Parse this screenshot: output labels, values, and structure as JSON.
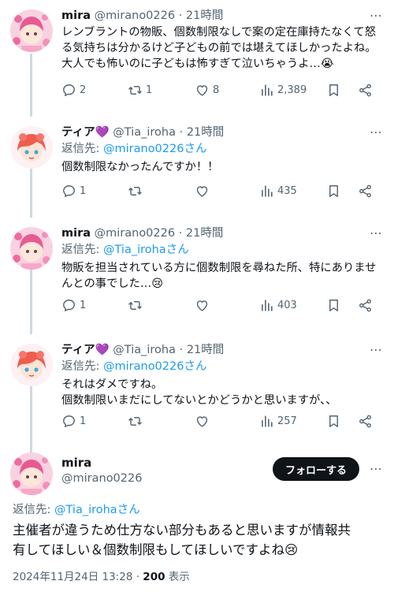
{
  "colors": {
    "accent": "#1d9bf0",
    "muted": "#536471",
    "text": "#0f1419",
    "thread_line": "#cfd9de"
  },
  "tweets": [
    {
      "name": "mira",
      "handle": "@mirano0226",
      "time": "· 21時間",
      "reply_prefix": "",
      "reply_to": "",
      "text_lines": [
        "レンブラントの物販、個数制限なしで案の定在庫持たなくて怒",
        "る気持ちは分かるけど子どもの前では堪えてほしかったよね。",
        "大人でも怖いのに子どもは怖すぎて泣いちゃうよ…😭"
      ],
      "replies": "2",
      "retweets": "1",
      "likes": "8",
      "views": "2,389",
      "avatar": "mira-avatar"
    },
    {
      "name": "ティア💜",
      "handle": "@Tia_iroha",
      "time": "· 21時間",
      "reply_prefix": "返信先: ",
      "reply_to": "@mirano0226さん",
      "text_lines": [
        "個数制限なかったんですか！！"
      ],
      "replies": "1",
      "retweets": "",
      "likes": "",
      "views": "435",
      "avatar": "tia-avatar"
    },
    {
      "name": "mira",
      "handle": "@mirano0226",
      "time": "· 21時間",
      "reply_prefix": "返信先: ",
      "reply_to": "@Tia_irohaさん",
      "text_lines": [
        "物販を担当されている方に個数制限を尋ねた所、特にありませ",
        "んとの事でした…😢"
      ],
      "replies": "1",
      "retweets": "",
      "likes": "",
      "views": "403",
      "avatar": "mira-avatar"
    },
    {
      "name": "ティア💜",
      "handle": "@Tia_iroha",
      "time": "· 21時間",
      "reply_prefix": "返信先: ",
      "reply_to": "@mirano0226さん",
      "text_lines": [
        "それはダメですね。",
        "個数制限いまだにしてないとかどうかと思いますが、、"
      ],
      "replies": "1",
      "retweets": "",
      "likes": "",
      "views": "257",
      "avatar": "tia-avatar"
    }
  ],
  "main_tweet": {
    "name": "mira",
    "handle": "@mirano0226",
    "follow_label": "フォローする",
    "reply_prefix": "返信先: ",
    "reply_to": "@Tia_irohaさん",
    "text_lines": [
      "主催者が違うため仕方ない部分もあると思いますが情報共",
      "有してほしい＆個数制限もしてほしいですよね😢"
    ],
    "timestamp": "2024年11月24日 13:28 · ",
    "views_count": "200",
    "views_label": " 表示"
  },
  "icons": [
    "reply-icon",
    "retweet-icon",
    "like-icon",
    "views-icon",
    "bookmark-icon",
    "share-icon",
    "more-icon"
  ]
}
